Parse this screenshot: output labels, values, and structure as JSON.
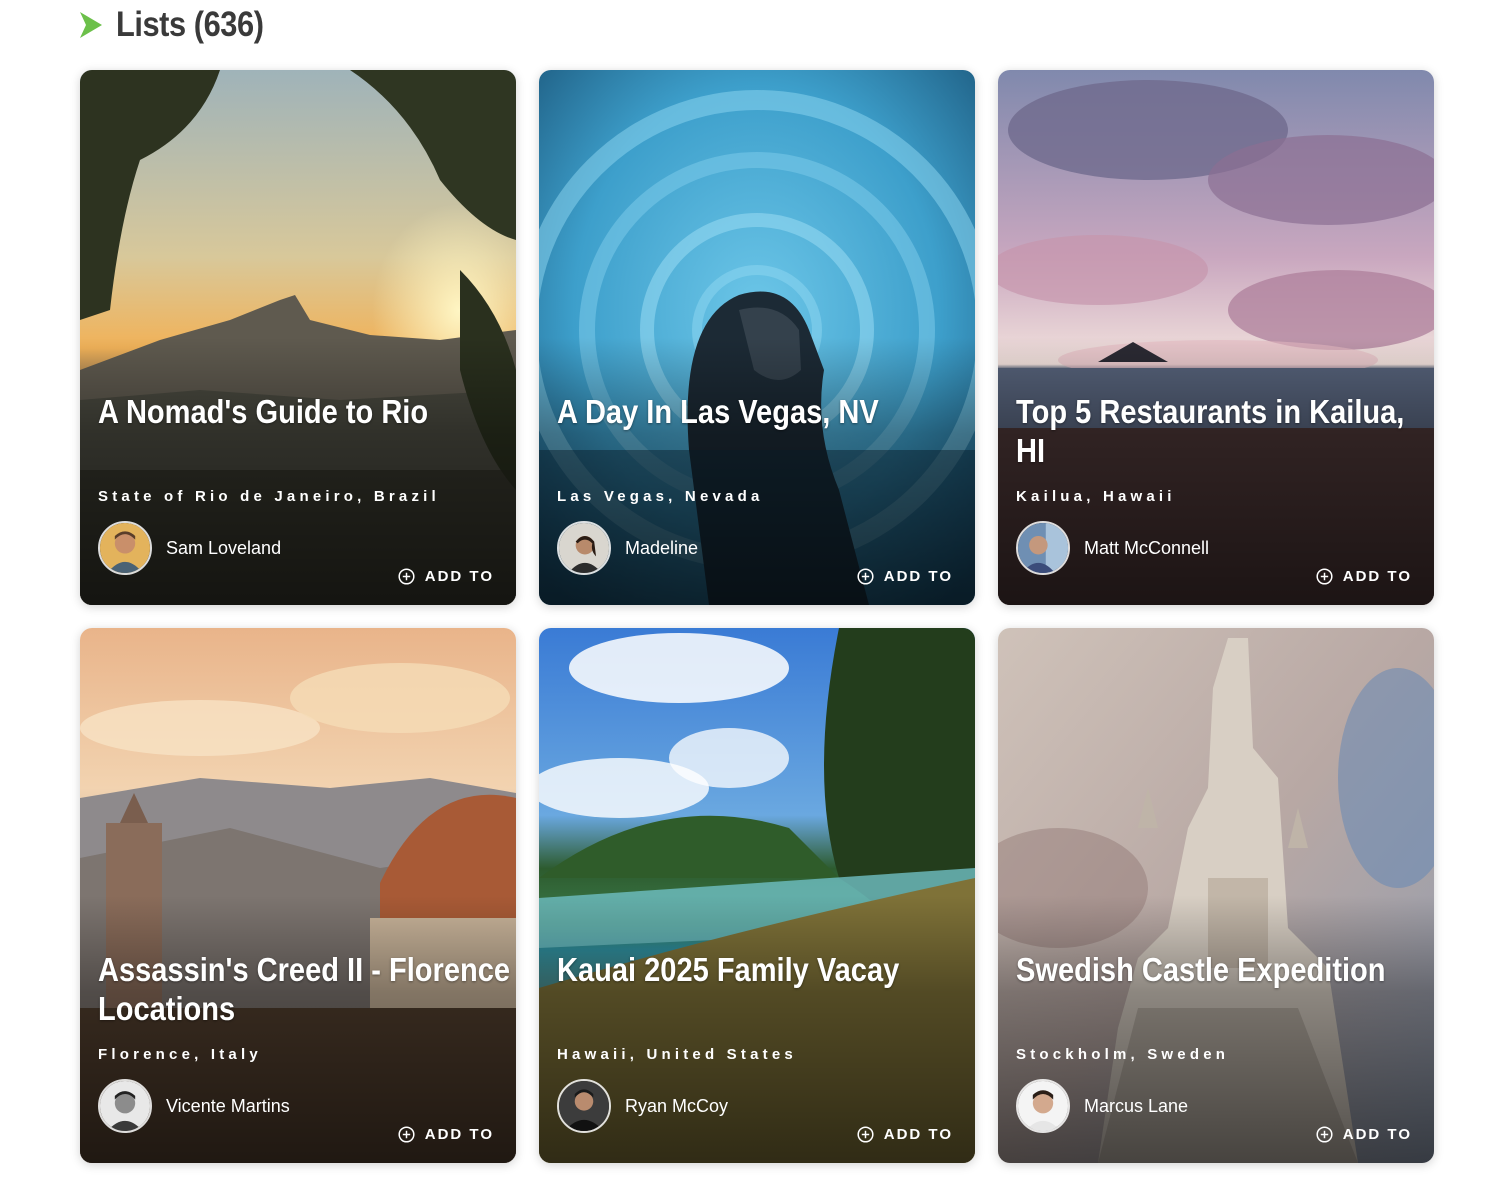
{
  "section": {
    "title": "Lists (636)",
    "icon": "chevron-right-icon",
    "accent_color": "#6cc04a"
  },
  "cards": [
    {
      "title": "A Nomad's Guide to Rio",
      "location": "State of Rio de Janeiro, Brazil",
      "author": "Sam Loveland",
      "action_label": "ADD TO"
    },
    {
      "title": "A Day In Las Vegas, NV",
      "location": "Las Vegas, Nevada",
      "author": "Madeline",
      "action_label": "ADD TO"
    },
    {
      "title": "Top 5 Restaurants in Kailua, HI",
      "location": "Kailua, Hawaii",
      "author": "Matt McConnell",
      "action_label": "ADD TO"
    },
    {
      "title": "Assassin's Creed II - Florence Locations",
      "location": "Florence, Italy",
      "author": "Vicente Martins",
      "action_label": "ADD TO"
    },
    {
      "title": "Kauai 2025 Family Vacay",
      "location": "Hawaii, United States",
      "author": "Ryan McCoy",
      "action_label": "ADD TO"
    },
    {
      "title": "Swedish Castle Expedition",
      "location": "Stockholm, Sweden",
      "author": "Marcus Lane",
      "action_label": "ADD TO"
    }
  ]
}
